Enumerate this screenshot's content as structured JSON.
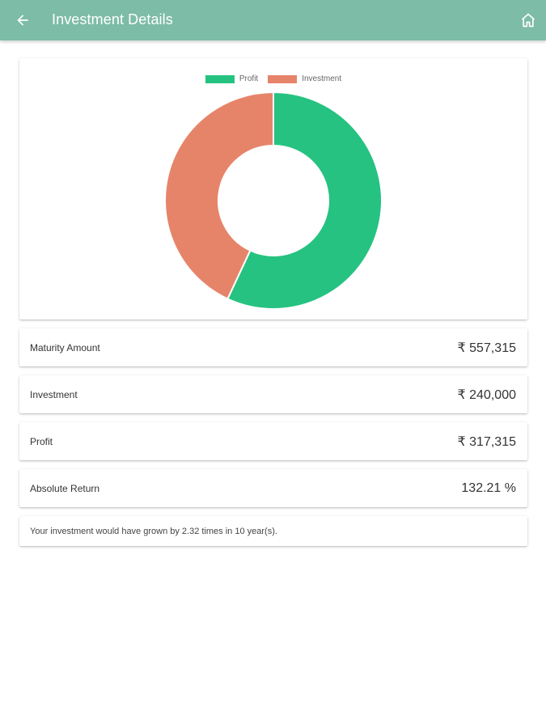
{
  "header": {
    "title": "Investment Details",
    "back_icon": "arrow-left-icon",
    "home_icon": "home-icon",
    "color": "#7dbca6"
  },
  "chart_data": {
    "type": "pie",
    "donut": true,
    "legend_position": "top",
    "categories": [
      "Profit",
      "Investment"
    ],
    "values": [
      317315,
      240000
    ],
    "colors": [
      "#26c281",
      "#e6846a"
    ]
  },
  "details": [
    {
      "label": "Maturity Amount",
      "value": "₹ 557,315"
    },
    {
      "label": "Investment",
      "value": "₹ 240,000"
    },
    {
      "label": "Profit",
      "value": "₹ 317,315"
    },
    {
      "label": "Absolute Return",
      "value": "132.21 %"
    }
  ],
  "summary": "Your investment would have grown by 2.32 times in 10 year(s)."
}
